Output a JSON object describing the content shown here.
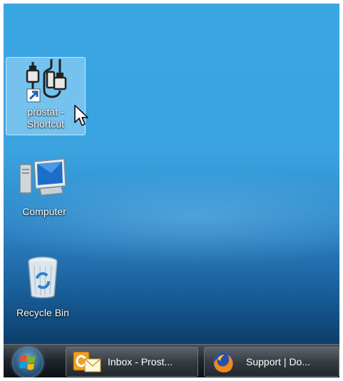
{
  "desktop": {
    "icons": [
      {
        "label_line1": "prostat -",
        "label_line2": "Shortcut",
        "icon": "prostat-shortcut-icon"
      },
      {
        "label": "Computer",
        "icon": "computer-icon"
      },
      {
        "label": "Recycle Bin",
        "icon": "recycle-bin-icon"
      }
    ]
  },
  "taskbar": {
    "start_icon": "windows-start-orb-icon",
    "buttons": [
      {
        "label": "Inbox - Prost...",
        "icon": "outlook-icon"
      },
      {
        "label": "Support | Do...",
        "icon": "firefox-icon"
      }
    ]
  },
  "colors": {
    "desktop_top": "#3aa6e2",
    "desktop_bottom": "#082b4d",
    "selection": "#bee6ff",
    "taskbar": "#20262c"
  }
}
